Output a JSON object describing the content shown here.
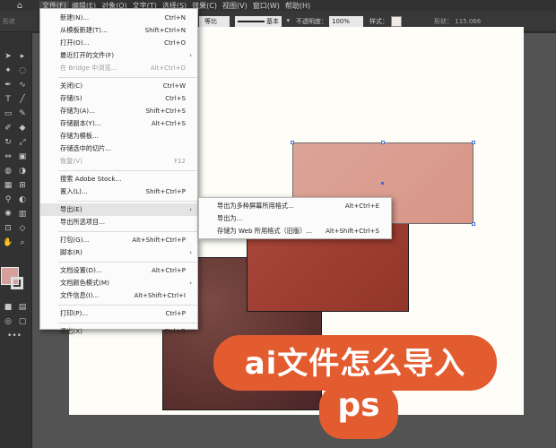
{
  "menubar": {
    "items": [
      "文件(F)",
      "编辑(E)",
      "对象(O)",
      "文字(T)",
      "选择(S)",
      "效果(C)",
      "视图(V)",
      "窗口(W)",
      "帮助(H)"
    ]
  },
  "controlbar": {
    "no_selection": "形状",
    "ratio_value": "等比",
    "stroke_value": "基本",
    "opacity_label": "不透明度：",
    "opacity_value": "100%",
    "style_label": "样式：",
    "shape_label": "形状：",
    "coord_value": "115.066"
  },
  "file_menu": {
    "items": [
      {
        "label": "新建(N)...",
        "shortcut": "Ctrl+N"
      },
      {
        "label": "从模板新建(T)...",
        "shortcut": "Shift+Ctrl+N"
      },
      {
        "label": "打开(O)...",
        "shortcut": "Ctrl+O"
      },
      {
        "label": "最近打开的文件(F)",
        "shortcut": ""
      },
      {
        "label": "在 Bridge 中浏览...",
        "shortcut": "Alt+Ctrl+O"
      },
      {
        "label": "关闭(C)",
        "shortcut": "Ctrl+W"
      },
      {
        "label": "存储(S)",
        "shortcut": "Ctrl+S"
      },
      {
        "label": "存储为(A)...",
        "shortcut": "Shift+Ctrl+S"
      },
      {
        "label": "存储副本(Y)...",
        "shortcut": "Alt+Ctrl+S"
      },
      {
        "label": "存储为模板...",
        "shortcut": ""
      },
      {
        "label": "存储选中的切片...",
        "shortcut": ""
      },
      {
        "label": "恢复(V)",
        "shortcut": "F12"
      },
      {
        "label": "搜索 Adobe Stock...",
        "shortcut": ""
      },
      {
        "label": "置入(L)...",
        "shortcut": "Shift+Ctrl+P"
      },
      {
        "label": "导出(E)",
        "shortcut": ""
      },
      {
        "label": "导出所选项目...",
        "shortcut": ""
      },
      {
        "label": "打包(G)...",
        "shortcut": "Alt+Shift+Ctrl+P"
      },
      {
        "label": "脚本(R)",
        "shortcut": ""
      },
      {
        "label": "文档设置(D)...",
        "shortcut": "Alt+Ctrl+P"
      },
      {
        "label": "文档颜色模式(M)",
        "shortcut": ""
      },
      {
        "label": "文件信息(I)...",
        "shortcut": "Alt+Shift+Ctrl+I"
      },
      {
        "label": "打印(P)...",
        "shortcut": "Ctrl+P"
      },
      {
        "label": "退出(X)",
        "shortcut": "Ctrl+Q"
      }
    ]
  },
  "export_submenu": {
    "items": [
      {
        "label": "导出为多种屏幕所用格式...",
        "shortcut": "Alt+Ctrl+E"
      },
      {
        "label": "导出为...",
        "shortcut": ""
      },
      {
        "label": "存储为 Web 所用格式（旧版）...",
        "shortcut": "Alt+Shift+Ctrl+S"
      }
    ]
  },
  "overlay": {
    "line1": "ai文件怎么导入",
    "line2": "ps"
  },
  "colors": {
    "top_rect": "#dba498",
    "mid_rect": "#a8463a",
    "back_rect": "#5e3330",
    "overlay_bg": "#e35c2f"
  }
}
